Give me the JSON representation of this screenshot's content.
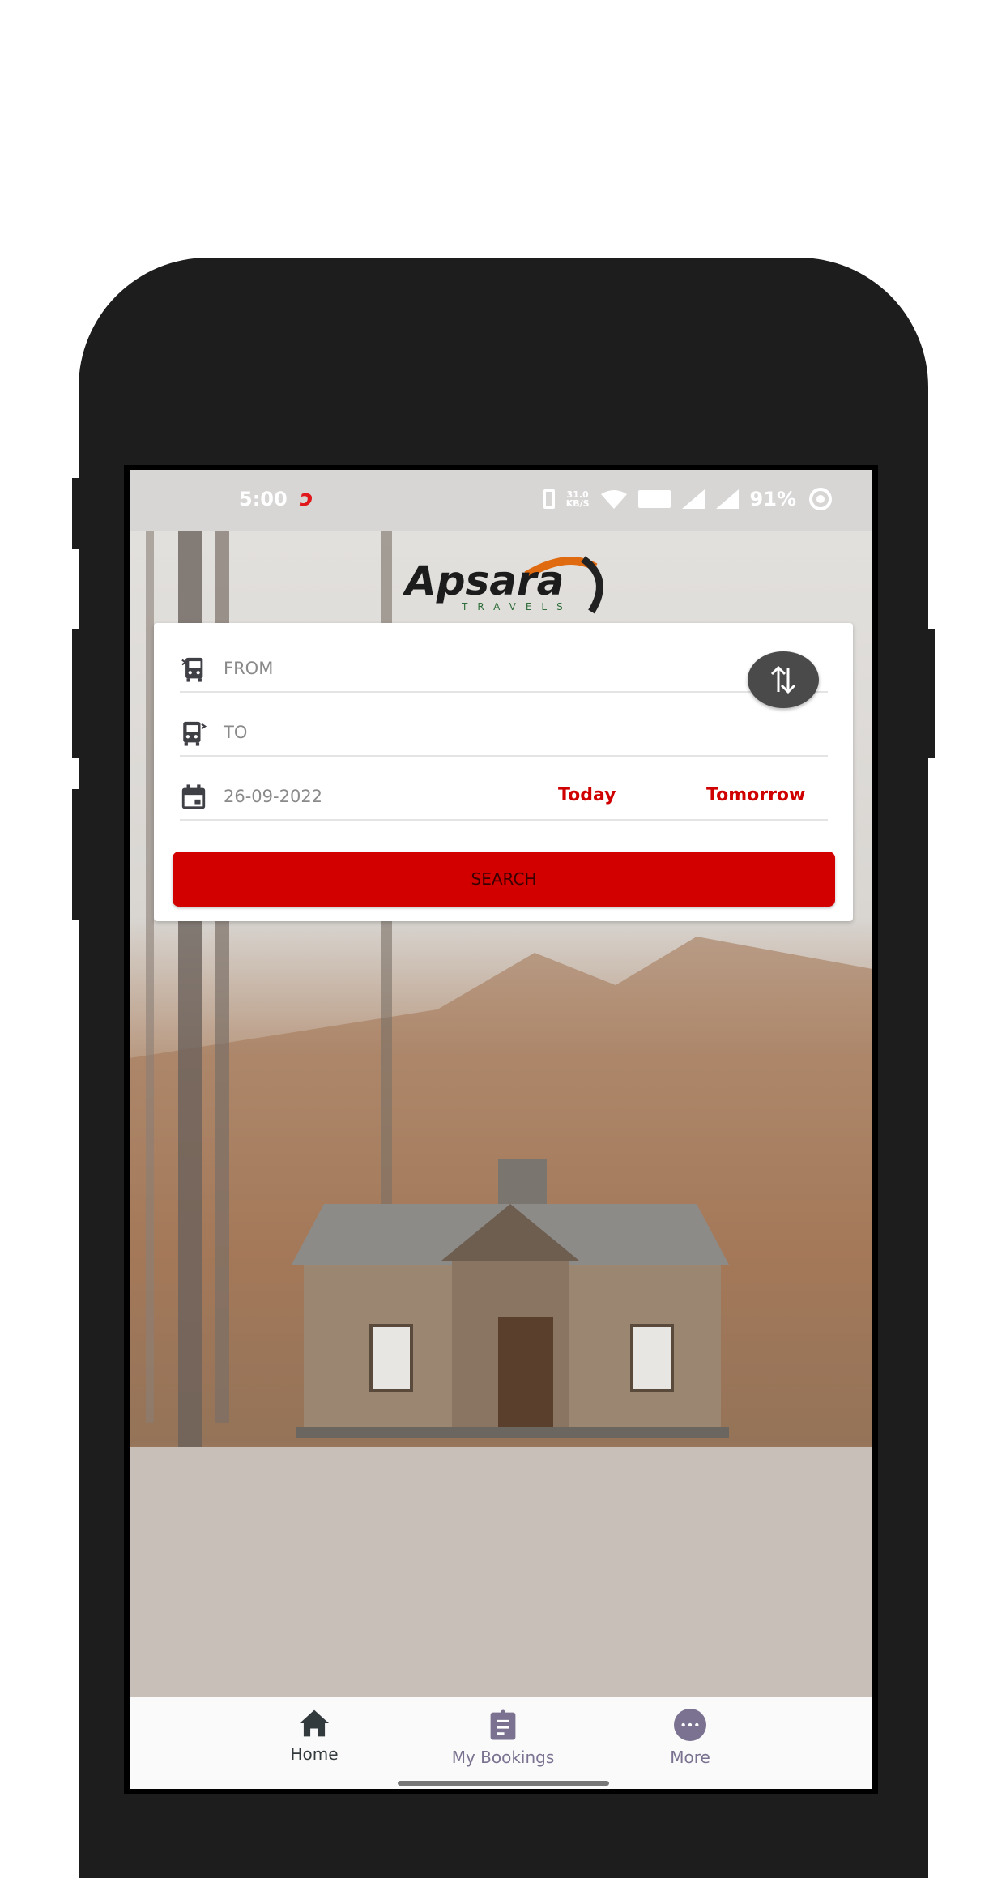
{
  "status_bar": {
    "time": "5:00",
    "net_speed": "31.0",
    "net_unit": "KB/S",
    "battery": "91%"
  },
  "brand": {
    "name": "Apsara",
    "tagline": "TRAVELS"
  },
  "form": {
    "from_placeholder": "FROM",
    "to_placeholder": "TO",
    "date": "26-09-2022",
    "today_label": "Today",
    "tomorrow_label": "Tomorrow",
    "search_label": "SEARCH"
  },
  "bottom_nav": {
    "items": [
      {
        "label": "Home",
        "icon": "home-icon",
        "active": true
      },
      {
        "label": "My Bookings",
        "icon": "clipboard-icon"
      },
      {
        "label": "More",
        "icon": "more-icon"
      }
    ]
  },
  "colors": {
    "accent": "#d30000",
    "nav_active": "#333a3d",
    "nav_inactive": "#7a7290"
  }
}
